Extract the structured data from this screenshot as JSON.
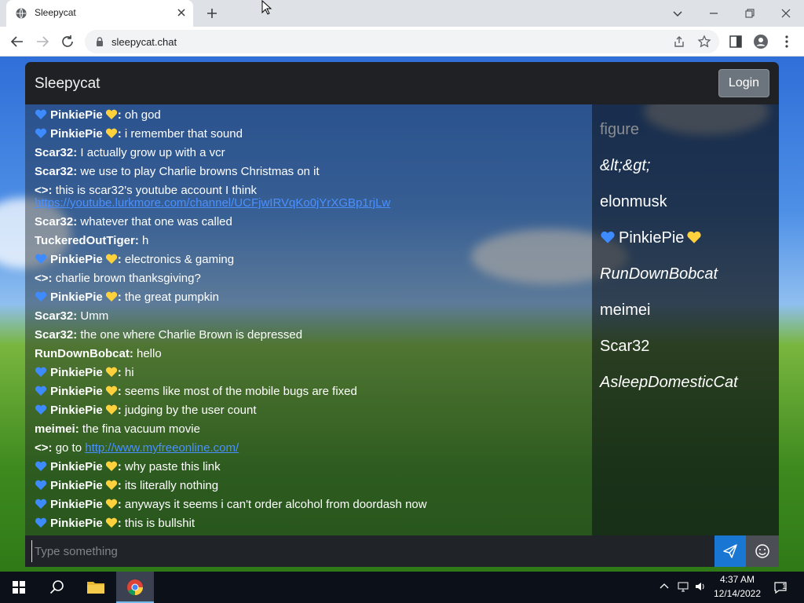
{
  "browser": {
    "tab_title": "Sleepycat",
    "url": "sleepycat.chat"
  },
  "app": {
    "title": "Sleepycat",
    "login_label": "Login",
    "input_placeholder": "Type something",
    "accent_color": "#1976d2",
    "link_color": "#4a90ff"
  },
  "messages": [
    {
      "heart": true,
      "user": "PinkiePie",
      "sep": ":",
      "text": "oh god"
    },
    {
      "heart": true,
      "user": "PinkiePie",
      "sep": ":",
      "text": "i remember that sound"
    },
    {
      "heart": false,
      "user": "Scar32",
      "sep": ":",
      "text": "I actually grow up with a vcr"
    },
    {
      "heart": false,
      "user": "Scar32",
      "sep": ":",
      "text": "we use to play Charlie browns Christmas on it"
    },
    {
      "heart": false,
      "user": "<>",
      "sep": ":",
      "text": "this is scar32's youtube account I think"
    },
    {
      "heart": false,
      "user": "Scar32",
      "sep": ":",
      "text": "whatever that one was called"
    },
    {
      "heart": false,
      "user": "TuckeredOutTiger",
      "sep": ":",
      "text": "h"
    },
    {
      "heart": true,
      "user": "PinkiePie",
      "sep": ":",
      "text": "electronics & gaming"
    },
    {
      "heart": false,
      "user": "<>",
      "sep": ":",
      "text": "charlie brown thanksgiving?"
    },
    {
      "heart": true,
      "user": "PinkiePie",
      "sep": ":",
      "text": "the great pumpkin"
    },
    {
      "heart": false,
      "user": "Scar32",
      "sep": ":",
      "text": "Umm"
    },
    {
      "heart": false,
      "user": "Scar32",
      "sep": ":",
      "text": "the one where Charlie Brown is depressed"
    },
    {
      "heart": false,
      "user": "RunDownBobcat",
      "sep": ":",
      "text": "hello"
    },
    {
      "heart": true,
      "user": "PinkiePie",
      "sep": ":",
      "text": "hi"
    },
    {
      "heart": true,
      "user": "PinkiePie",
      "sep": ":",
      "text": "seems like most of the mobile bugs are fixed"
    },
    {
      "heart": true,
      "user": "PinkiePie",
      "sep": ":",
      "text": "judging by the user count"
    },
    {
      "heart": false,
      "user": "meimei",
      "sep": ":",
      "text": "the fina vacuum movie"
    },
    {
      "heart": false,
      "user": "<>",
      "sep": ":",
      "text": "go to"
    },
    {
      "heart": true,
      "user": "PinkiePie",
      "sep": ":",
      "text": "why paste this link"
    },
    {
      "heart": true,
      "user": "PinkiePie",
      "sep": ":",
      "text": "its literally nothing"
    },
    {
      "heart": true,
      "user": "PinkiePie",
      "sep": ":",
      "text": "anyways it seems i can't order alcohol from doordash now"
    },
    {
      "heart": true,
      "user": "PinkiePie",
      "sep": ":",
      "text": "this is bullshit"
    }
  ],
  "links": {
    "youtube": "https://youtube.lurkmore.com/channel/UCFjwIRVqKo0jYrXGBp1rjLw",
    "freeonline": "http://www.myfreeonline.com/"
  },
  "userlist": [
    {
      "name": "figure",
      "style": "muted"
    },
    {
      "name": "&lt;&gt;",
      "style": "italic"
    },
    {
      "name": "elonmusk",
      "style": "normal"
    },
    {
      "name": "PinkiePie",
      "style": "hearts"
    },
    {
      "name": "RunDownBobcat",
      "style": "italic"
    },
    {
      "name": "meimei",
      "style": "normal"
    },
    {
      "name": "Scar32",
      "style": "normal"
    },
    {
      "name": "AsleepDomesticCat",
      "style": "italic"
    }
  ],
  "taskbar": {
    "time": "4:37 AM",
    "date": "12/14/2022",
    "notifications": "1"
  }
}
